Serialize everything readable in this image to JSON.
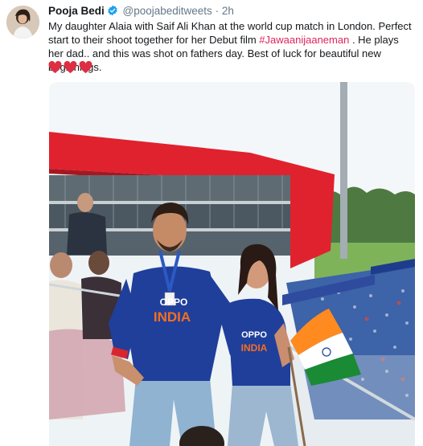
{
  "tweet": {
    "author_name": "Pooja Bedi",
    "handle": "@poojabeditweets",
    "separator": "·",
    "time": "2h",
    "body_before": "My daughter Alaia with Saif Ali Khan at the world cup match in London. Perfect start to their shoot together for her Debut film ",
    "hashtag": "#Jawaanijaaneman",
    "body_after": " . He plays her dad.. and this was shot on fathers day. Best of luck for beautiful new beginnings.",
    "emoji": [
      "❤",
      "❤",
      "❤"
    ],
    "emoji_color": "#dd2e44",
    "verified_color": "#1da1f2",
    "hashtag_color": "#e0245e"
  },
  "photo": {
    "jersey_text": "INDIA",
    "sponsor_text": "OPPO"
  }
}
